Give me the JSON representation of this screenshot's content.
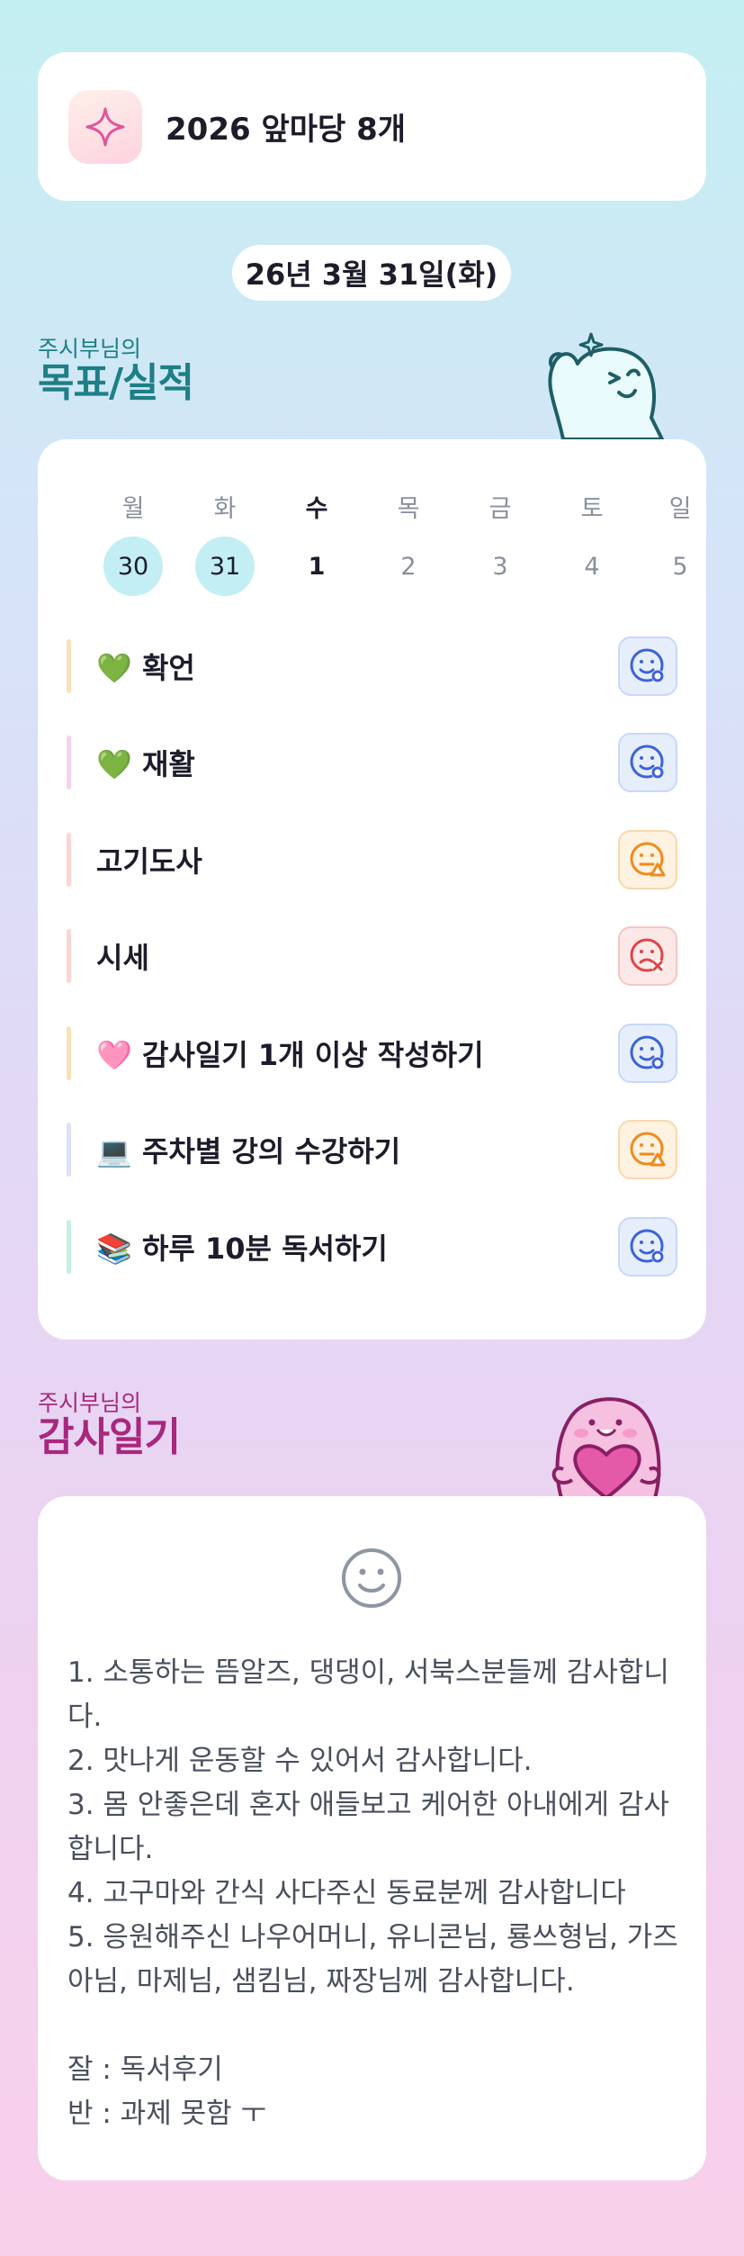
{
  "banner": {
    "title": "2026 앞마당 8개",
    "icon": "sparkle-icon"
  },
  "date": "26년 3월 31일(화)",
  "goals_section": {
    "sub": "주시부님의",
    "title": "목표/실적"
  },
  "week": [
    {
      "day": "월",
      "date": "30",
      "state": "done"
    },
    {
      "day": "화",
      "date": "31",
      "state": "done"
    },
    {
      "day": "수",
      "date": "1",
      "state": "today"
    },
    {
      "day": "목",
      "date": "2",
      "state": "future"
    },
    {
      "day": "금",
      "date": "3",
      "state": "future"
    },
    {
      "day": "토",
      "date": "4",
      "state": "future"
    },
    {
      "day": "일",
      "date": "5",
      "state": "future"
    }
  ],
  "goals": [
    {
      "label": "💚 확언",
      "bar_color": "#fbe0b5",
      "status": "good"
    },
    {
      "label": "💚 재활",
      "bar_color": "#f8d2ea",
      "status": "good"
    },
    {
      "label": "고기도사",
      "bar_color": "#fbd5d5",
      "status": "mid"
    },
    {
      "label": "시세",
      "bar_color": "#fbd5d5",
      "status": "bad"
    },
    {
      "label": "🩷 감사일기 1개 이상 작성하기",
      "bar_color": "#fbe0b5",
      "status": "good"
    },
    {
      "label": "💻 주차별 강의 수강하기",
      "bar_color": "#dcdff8",
      "status": "mid"
    },
    {
      "label": "📚 하루 10분 독서하기",
      "bar_color": "#c6f0de",
      "status": "good"
    }
  ],
  "thanks_section": {
    "sub": "주시부님의",
    "title": "감사일기"
  },
  "thanks": {
    "icon": "smile-face-icon",
    "lines": [
      "1. 소통하는 뜸알즈, 댕댕이, 서북스분들께 감사합니다.",
      "2. 맛나게 운동할 수 있어서 감사합니다.",
      "3. 몸 안좋은데 혼자 애들보고 케어한 아내에게 감사합니다.",
      "4. 고구마와 간식 사다주신 동료분께 감사합니다",
      "5. 응원해주신 나우어머니, 유니콘님, 룡쓰형님, 가즈아님, 마제님, 샘킴님, 짜장님께 감사합니다."
    ],
    "extra": [
      "잘 : 독서후기",
      "반 : 과제 못함 ㅜ"
    ]
  },
  "colors": {
    "accent_teal": "#1e7f86",
    "accent_magenta": "#a8287d",
    "status_good": "#3b63d9",
    "status_mid": "#f08a1c",
    "status_bad": "#e04444"
  }
}
